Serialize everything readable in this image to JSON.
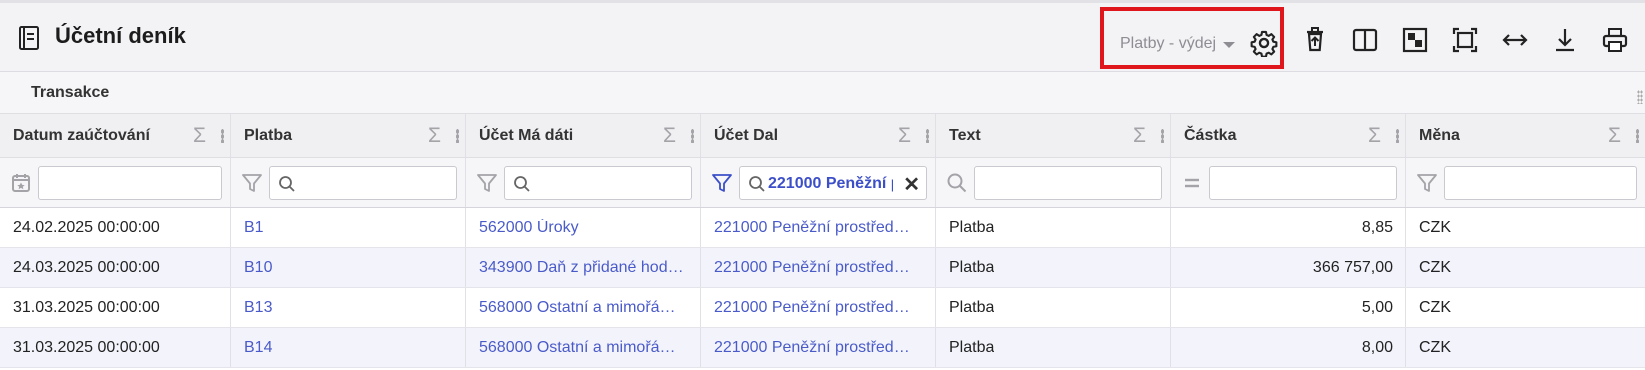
{
  "header": {
    "title": "Účetní deník",
    "view_select": "Platby - výdej"
  },
  "group": {
    "label": "Transakce"
  },
  "columns": [
    {
      "label": "Datum zaúčtování"
    },
    {
      "label": "Platba"
    },
    {
      "label": "Účet Má dáti"
    },
    {
      "label": "Účet Dal"
    },
    {
      "label": "Text"
    },
    {
      "label": "Částka"
    },
    {
      "label": "Měna"
    }
  ],
  "filters": {
    "ucet_dal_value": "221000 Peněžní p",
    "clear_symbol": "✕"
  },
  "rows": [
    {
      "datum": "24.02.2025 00:00:00",
      "platba": "B1",
      "ma_dati": "562000 Úroky",
      "dal": "221000 Peněžní prostřed…",
      "text": "Platba",
      "castka": "8,85",
      "mena": "CZK"
    },
    {
      "datum": "24.03.2025 00:00:00",
      "platba": "B10",
      "ma_dati": "343900 Daň z přidané hod…",
      "dal": "221000 Peněžní prostřed…",
      "text": "Platba",
      "castka": "366 757,00",
      "mena": "CZK"
    },
    {
      "datum": "31.03.2025 00:00:00",
      "platba": "B13",
      "ma_dati": "568000 Ostatní a mimořá…",
      "dal": "221000 Peněžní prostřed…",
      "text": "Platba",
      "castka": "5,00",
      "mena": "CZK"
    },
    {
      "datum": "31.03.2025 00:00:00",
      "platba": "B14",
      "ma_dati": "568000 Ostatní a mimořá…",
      "dal": "221000 Peněžní prostřed…",
      "text": "Platba",
      "castka": "8,00",
      "mena": "CZK"
    }
  ],
  "colors": {
    "accent": "#3c4fc8",
    "link": "#4a5bc9",
    "highlight_border": "#e0161d"
  }
}
